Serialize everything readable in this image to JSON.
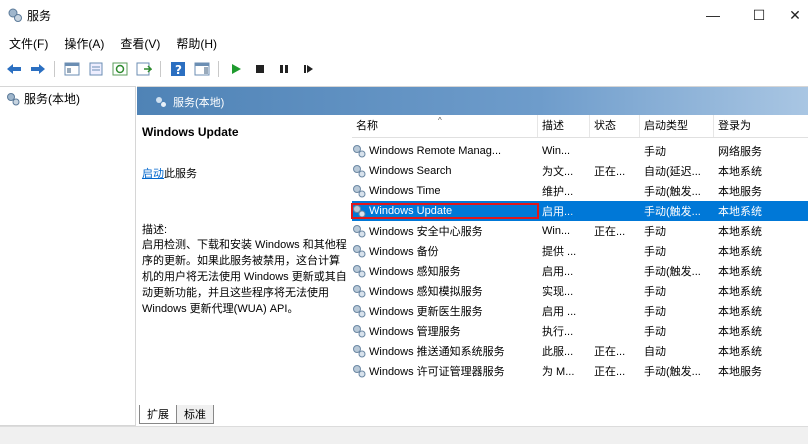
{
  "window": {
    "title": "服务",
    "minimize": "—",
    "maximize": "☐",
    "close": "✕"
  },
  "menu": [
    "文件(F)",
    "操作(A)",
    "查看(V)",
    "帮助(H)"
  ],
  "toolbar_icons": [
    "back-arrow",
    "forward-arrow",
    "show-console-tree",
    "properties",
    "refresh",
    "export-list",
    "help",
    "show-action-pane",
    "start-service",
    "stop-service",
    "pause-service",
    "restart-service"
  ],
  "tree": {
    "item": "服务(本地)"
  },
  "pane": {
    "title": "服务(本地)"
  },
  "description": {
    "service_title": "Windows Update",
    "start_link": "启动",
    "start_suffix": "此服务",
    "label": "描述:",
    "text": "启用检测、下载和安装 Windows 和其他程序的更新。如果此服务被禁用，这台计算机的用户将无法使用 Windows 更新或其自动更新功能，并且这些程序将无法使用 Windows 更新代理(WUA) API。"
  },
  "table": {
    "columns": [
      "名称",
      "描述",
      "状态",
      "启动类型",
      "登录为"
    ],
    "rows": [
      [
        "Windows Remote Manag...",
        "Win...",
        "",
        "手动",
        "网络服务"
      ],
      [
        "Windows Search",
        "为文...",
        "正在...",
        "自动(延迟...",
        "本地系统"
      ],
      [
        "Windows Time",
        "维护...",
        "",
        "手动(触发...",
        "本地服务"
      ],
      [
        "Windows Update",
        "启用...",
        "",
        "手动(触发...",
        "本地系统"
      ],
      [
        "Windows 安全中心服务",
        "Win...",
        "正在...",
        "手动",
        "本地系统"
      ],
      [
        "Windows 备份",
        "提供 ...",
        "",
        "手动",
        "本地系统"
      ],
      [
        "Windows 感知服务",
        "启用...",
        "",
        "手动(触发...",
        "本地系统"
      ],
      [
        "Windows 感知模拟服务",
        "实现...",
        "",
        "手动",
        "本地系统"
      ],
      [
        "Windows 更新医生服务",
        "启用 ...",
        "",
        "手动",
        "本地系统"
      ],
      [
        "Windows 管理服务",
        "执行...",
        "",
        "手动",
        "本地系统"
      ],
      [
        "Windows 推送通知系统服务",
        "此服...",
        "正在...",
        "自动",
        "本地系统"
      ],
      [
        "Windows 许可证管理器服务",
        "为 M...",
        "正在...",
        "手动(触发...",
        "本地服务"
      ]
    ],
    "selected_index": 3
  },
  "tabs": [
    "扩展",
    "标准"
  ],
  "colors": {
    "selection": "#0078d7",
    "highlight_box": "#e0161b",
    "header": "#4f83b6"
  }
}
